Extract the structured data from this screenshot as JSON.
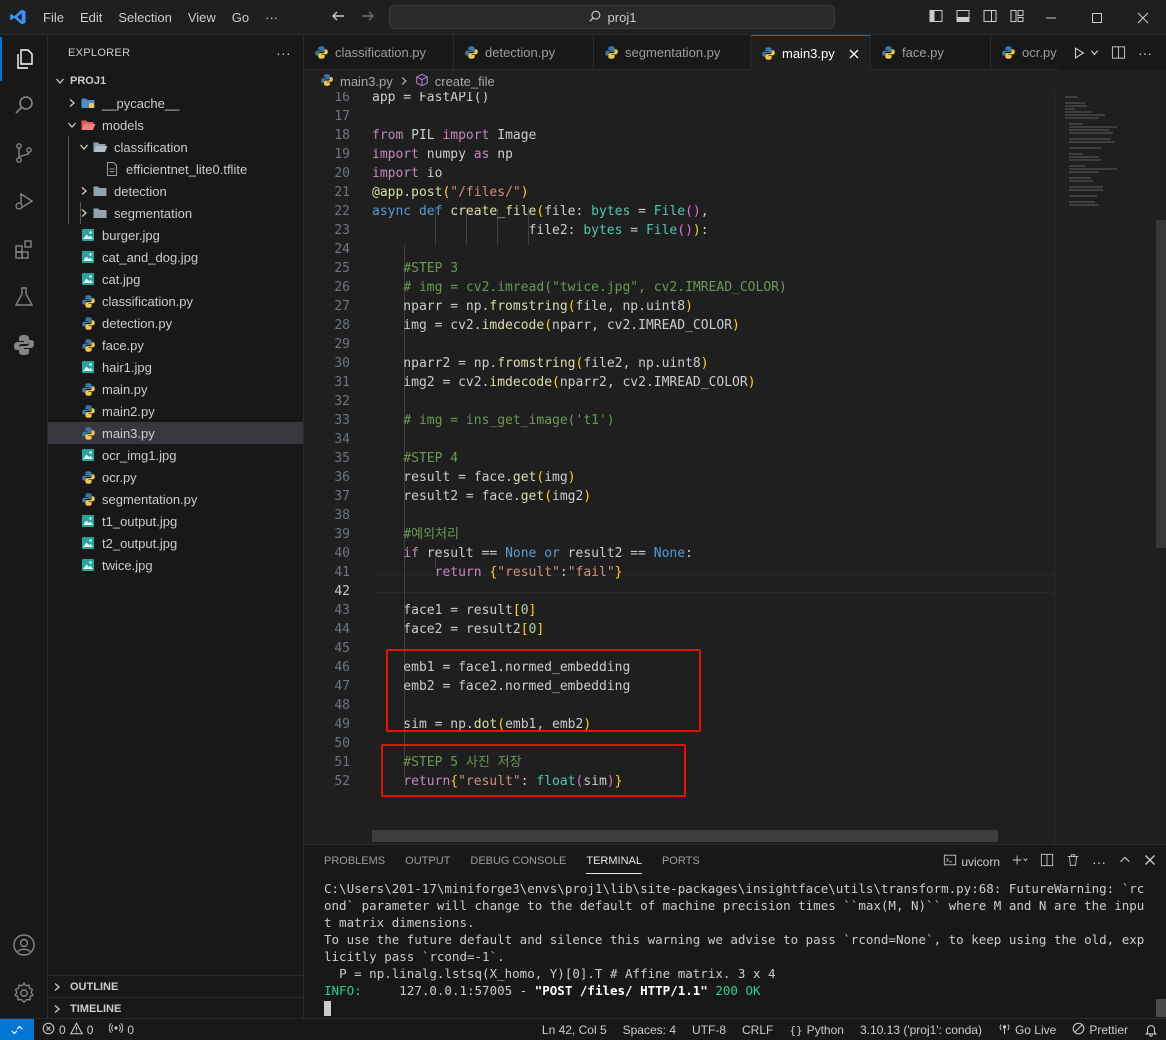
{
  "menu": [
    "File",
    "Edit",
    "Selection",
    "View",
    "Go",
    "···"
  ],
  "search": {
    "text": "proj1"
  },
  "explorer": {
    "title": "EXPLORER",
    "more": "···",
    "root": "PROJ1",
    "items": [
      {
        "label": "__pycache__",
        "depth": 1,
        "kind": "folder-py",
        "expanded": false
      },
      {
        "label": "models",
        "depth": 1,
        "kind": "folder-models",
        "expanded": true
      },
      {
        "label": "classification",
        "depth": 2,
        "kind": "folder",
        "expanded": true
      },
      {
        "label": "efficientnet_lite0.tflite",
        "depth": 3,
        "kind": "file"
      },
      {
        "label": "detection",
        "depth": 2,
        "kind": "folder",
        "expanded": false
      },
      {
        "label": "segmentation",
        "depth": 2,
        "kind": "folder",
        "expanded": false
      },
      {
        "label": "burger.jpg",
        "depth": 1,
        "kind": "image"
      },
      {
        "label": "cat_and_dog.jpg",
        "depth": 1,
        "kind": "image"
      },
      {
        "label": "cat.jpg",
        "depth": 1,
        "kind": "image"
      },
      {
        "label": "classification.py",
        "depth": 1,
        "kind": "python"
      },
      {
        "label": "detection.py",
        "depth": 1,
        "kind": "python"
      },
      {
        "label": "face.py",
        "depth": 1,
        "kind": "python"
      },
      {
        "label": "hair1.jpg",
        "depth": 1,
        "kind": "image"
      },
      {
        "label": "main.py",
        "depth": 1,
        "kind": "python"
      },
      {
        "label": "main2.py",
        "depth": 1,
        "kind": "python"
      },
      {
        "label": "main3.py",
        "depth": 1,
        "kind": "python",
        "selected": true
      },
      {
        "label": "ocr_img1.jpg",
        "depth": 1,
        "kind": "image"
      },
      {
        "label": "ocr.py",
        "depth": 1,
        "kind": "python"
      },
      {
        "label": "segmentation.py",
        "depth": 1,
        "kind": "python"
      },
      {
        "label": "t1_output.jpg",
        "depth": 1,
        "kind": "image"
      },
      {
        "label": "t2_output.jpg",
        "depth": 1,
        "kind": "image"
      },
      {
        "label": "twice.jpg",
        "depth": 1,
        "kind": "image"
      }
    ],
    "outline": "OUTLINE",
    "timeline": "TIMELINE"
  },
  "tabs": [
    {
      "label": "classification.py",
      "active": false
    },
    {
      "label": "detection.py",
      "active": false
    },
    {
      "label": "segmentation.py",
      "active": false
    },
    {
      "label": "main3.py",
      "active": true
    },
    {
      "label": "face.py",
      "active": false
    },
    {
      "label": "ocr.py",
      "active": false
    }
  ],
  "breadcrumb": {
    "file": "main3.py",
    "symbol": "create_file"
  },
  "editor": {
    "current_line": 42,
    "lines": [
      {
        "n": 16,
        "html": "app = FastAPI()"
      },
      {
        "n": 17,
        "html": ""
      },
      {
        "n": 18,
        "html": "<span class='kc'>from</span> PIL <span class='kc'>import</span> Image"
      },
      {
        "n": 19,
        "html": "<span class='kc'>import</span> numpy <span class='kc'>as</span> np"
      },
      {
        "n": 20,
        "html": "<span class='kc'>import</span> io"
      },
      {
        "n": 21,
        "html": "<span class='fn'>@app.post</span><span class='br1'>(</span><span class='st'>\"/files/\"</span><span class='br1'>)</span>"
      },
      {
        "n": 22,
        "html": "<span class='kw'>async</span> <span class='kw'>def</span> <span class='fn'>create_file</span><span class='br1'>(</span>file: <span class='ty'>bytes</span> = <span class='ty'>File</span><span class='br2'>()</span>,"
      },
      {
        "n": 23,
        "html": "                    file2: <span class='ty'>bytes</span> = <span class='ty'>File</span><span class='br2'>()</span><span class='br1'>)</span>:"
      },
      {
        "n": 24,
        "html": ""
      },
      {
        "n": 25,
        "html": "    <span class='cm'>#STEP 3</span>"
      },
      {
        "n": 26,
        "html": "    <span class='cm'># img = cv2.imread(\"twice.jpg\", cv2.IMREAD_COLOR)</span>"
      },
      {
        "n": 27,
        "html": "    nparr = np.<span class='fn'>fromstring</span><span class='br1'>(</span>file, np.uint8<span class='br1'>)</span>"
      },
      {
        "n": 28,
        "html": "    img = cv2.<span class='fn'>imdecode</span><span class='br1'>(</span>nparr, cv2.IMREAD_COLOR<span class='br1'>)</span>"
      },
      {
        "n": 29,
        "html": ""
      },
      {
        "n": 30,
        "html": "    nparr2 = np.<span class='fn'>fromstring</span><span class='br1'>(</span>file2, np.uint8<span class='br1'>)</span>"
      },
      {
        "n": 31,
        "html": "    img2 = cv2.<span class='fn'>imdecode</span><span class='br1'>(</span>nparr2, cv2.IMREAD_COLOR<span class='br1'>)</span>"
      },
      {
        "n": 32,
        "html": ""
      },
      {
        "n": 33,
        "html": "    <span class='cm'># img = ins_get_image('t1')</span>"
      },
      {
        "n": 34,
        "html": ""
      },
      {
        "n": 35,
        "html": "    <span class='cm'>#STEP 4</span>"
      },
      {
        "n": 36,
        "html": "    result = face.<span class='fn'>get</span><span class='br1'>(</span>img<span class='br1'>)</span>"
      },
      {
        "n": 37,
        "html": "    result2 = face.<span class='fn'>get</span><span class='br1'>(</span>img2<span class='br1'>)</span>"
      },
      {
        "n": 38,
        "html": ""
      },
      {
        "n": 39,
        "html": "    <span class='cm'>#예외처리</span>"
      },
      {
        "n": 40,
        "html": "    <span class='kc'>if</span> result == <span class='kw'>None</span> <span class='kw'>or</span> result2 == <span class='kw'>None</span>:"
      },
      {
        "n": 41,
        "html": "        <span class='kc'>return</span> <span class='br1'>{</span><span class='st'>\"result\"</span>:<span class='st'>\"fail\"</span><span class='br1'>}</span>"
      },
      {
        "n": 42,
        "html": ""
      },
      {
        "n": 43,
        "html": "    face1 = result<span class='br1'>[</span><span class='nm'>0</span><span class='br1'>]</span>"
      },
      {
        "n": 44,
        "html": "    face2 = result2<span class='br1'>[</span><span class='nm'>0</span><span class='br1'>]</span>"
      },
      {
        "n": 45,
        "html": ""
      },
      {
        "n": 46,
        "html": "    emb1 = face1.normed_embedding"
      },
      {
        "n": 47,
        "html": "    emb2 = face2.normed_embedding"
      },
      {
        "n": 48,
        "html": ""
      },
      {
        "n": 49,
        "html": "    sim = np.<span class='fn'>dot</span><span class='br1'>(</span>emb1, emb2<span class='br1'>)</span>"
      },
      {
        "n": 50,
        "html": ""
      },
      {
        "n": 51,
        "html": "    <span class='cm'>#STEP 5 사진 저장</span>"
      },
      {
        "n": 52,
        "html": "    <span class='kc'>return</span><span class='br1'>{</span><span class='st'>\"result\"</span>: <span class='ty'>float</span><span class='br2'>(</span>sim<span class='br2'>)</span><span class='br1'>}</span>"
      }
    ]
  },
  "panel": {
    "tabs": [
      "PROBLEMS",
      "OUTPUT",
      "DEBUG CONSOLE",
      "TERMINAL",
      "PORTS"
    ],
    "active_tab": "TERMINAL",
    "terminal_name": "uvicorn",
    "terminal": {
      "line1": "C:\\Users\\201-17\\miniforge3\\envs\\proj1\\lib\\site-packages\\insightface\\utils\\transform.py:68: FutureWarning: `rcond` parameter will change to the default of machine precision times ``max(M, N)`` where M and N are the input matrix dimensions.",
      "line2": "To use the future default and silence this warning we advise to pass `rcond=None`, to keep using the old, explicitly pass `rcond=-1`.",
      "line3": "  P = np.linalg.lstsq(X_homo, Y)[0].T # Affine matrix. 3 x 4",
      "info_label": "INFO:",
      "info_addr": "     127.0.0.1:57005 - ",
      "info_req": "\"POST /files/ HTTP/1.1\"",
      "info_status": " 200 OK"
    }
  },
  "status": {
    "errors": "0",
    "warnings": "0",
    "ports": "0",
    "position": "Ln 42, Col 5",
    "spaces": "Spaces: 4",
    "encoding": "UTF-8",
    "eol": "CRLF",
    "language": "Python",
    "interpreter": "3.10.13 ('proj1': conda)",
    "golive": "Go Live",
    "prettier": "Prettier"
  },
  "colors": {
    "accent": "#0078d4",
    "highlight_box": "#e51400"
  }
}
